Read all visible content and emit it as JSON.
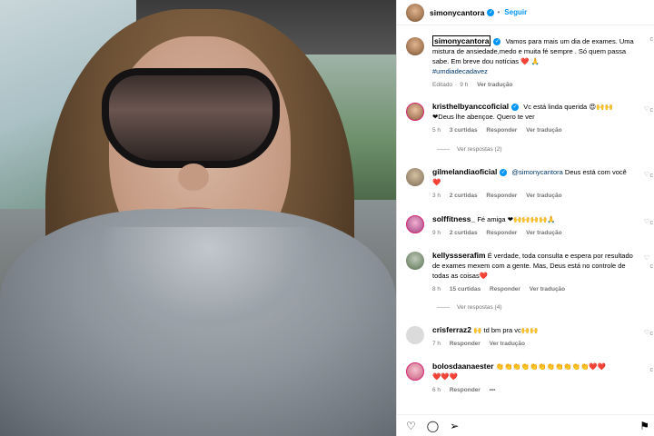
{
  "header": {
    "username": "simonycantora",
    "follow_label": "Seguir",
    "dot": "•"
  },
  "caption": {
    "username": "simonycantora",
    "text": "Vamos para mais um dia de exames. Uma mistura de ansiedade,medo e muita fé sempre . Só quem passa sabe. Em breve dou notícias",
    "emojis": "❤️ 🙏",
    "hashtag": "#umdiadecadavez",
    "edited": "Editado",
    "time": "9 h",
    "see_translation": "Ver tradução"
  },
  "comments": [
    {
      "username": "kristhelbyanccoficial",
      "text": "Vc está linda querida 😍🙌🙌",
      "text2": "❤Deus lhe abençoe. Quero te ver",
      "time": "5 h",
      "likes": "3 curtidas",
      "reply": "Responder",
      "translate": "Ver tradução",
      "view_replies": "Ver respostas (2)"
    },
    {
      "username": "gilmelandiaoficial",
      "mention": "@simonycantora",
      "text": "Deus está com você",
      "heart": "❤️",
      "time": "3 h",
      "likes": "2 curtidas",
      "reply": "Responder",
      "translate": "Ver tradução"
    },
    {
      "username": "solffitness_",
      "text": "Fé amiga ❤🙌🙌🙌🙌🙏",
      "time": "9 h",
      "likes": "2 curtidas",
      "reply": "Responder",
      "translate": "Ver tradução"
    },
    {
      "username": "kellyssserafim",
      "text": "É verdade, toda consulta e espera por resultado de exames mexem com a gente. Mas, Deus está no controle de todas as coisas",
      "heart": "❤️",
      "time": "8 h",
      "likes": "15 curtidas",
      "reply": "Responder",
      "translate": "Ver tradução",
      "view_replies": "Ver respostas (4)"
    },
    {
      "username": "crisferraz2",
      "text": "🙌 td bm pra vc🙌🙌",
      "time": "7 h",
      "reply": "Responder",
      "translate": "Ver tradução"
    },
    {
      "username": "bolosdaanaester",
      "text": "👏👏👏👏👏👏👏👏👏👏👏❤️❤️",
      "text2": "❤️❤️❤️",
      "time": "6 h",
      "reply": "Responder",
      "more": "•••"
    }
  ],
  "icons": {
    "like": "heart-icon",
    "comment": "comment-icon",
    "share": "share-icon",
    "save": "bookmark-icon"
  },
  "colors": {
    "accent": "#0095f6",
    "heart": "#ed4956",
    "story_ring": "#d62976"
  }
}
